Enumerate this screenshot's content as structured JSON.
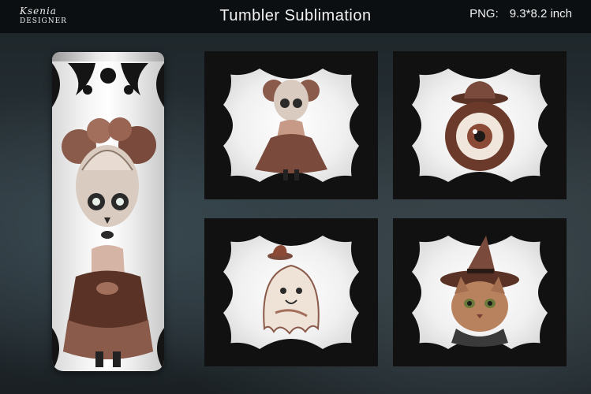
{
  "header": {
    "logo_line1": "Ksenia",
    "logo_line2": "DESIGNER",
    "title": "Tumbler Sublimation",
    "format_label": "PNG:",
    "format_size": "9.3*8.2 inch"
  },
  "colors": {
    "header_bg": "#0c0f11",
    "lace": "#111111",
    "copper": "#8a4a35",
    "brown": "#5a3326"
  },
  "cards": [
    {
      "subject": "skull-doll"
    },
    {
      "subject": "eyeball-with-hat"
    },
    {
      "subject": "ghost-with-hat"
    },
    {
      "subject": "cat-with-witch-hat"
    }
  ]
}
